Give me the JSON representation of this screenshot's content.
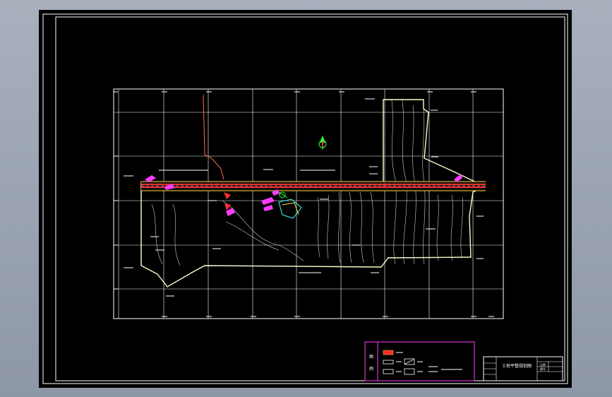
{
  "colors": {
    "background": "#000000",
    "frame": "#ffffff",
    "grid": "#ffffff",
    "road": "#ff2a2a",
    "road_edge": "#ffd23a",
    "boundary": "#ffffff",
    "boundary_dots": "#f4e13a",
    "contour": "#cfcfcf",
    "annotation_magenta": "#ff3bff",
    "marker_green": "#35ff35",
    "marker_red": "#ff3030",
    "legend_frame": "#ff3bff",
    "canal": "#ff6a4a",
    "pond": "#40ffff"
  },
  "icons": {
    "north_arrow": "north-arrow-icon",
    "legend_road_swatch": "road-legend-icon",
    "legend_line_swatch": "line-legend-icon",
    "legend_slope_swatch": "slope-legend-icon"
  },
  "legend": {
    "col_label_top": "图",
    "col_label_bottom": "例"
  },
  "title_block": {
    "drawing_name": "土地平整规划图",
    "scale_label": "比例",
    "sheet_label": "图号"
  }
}
